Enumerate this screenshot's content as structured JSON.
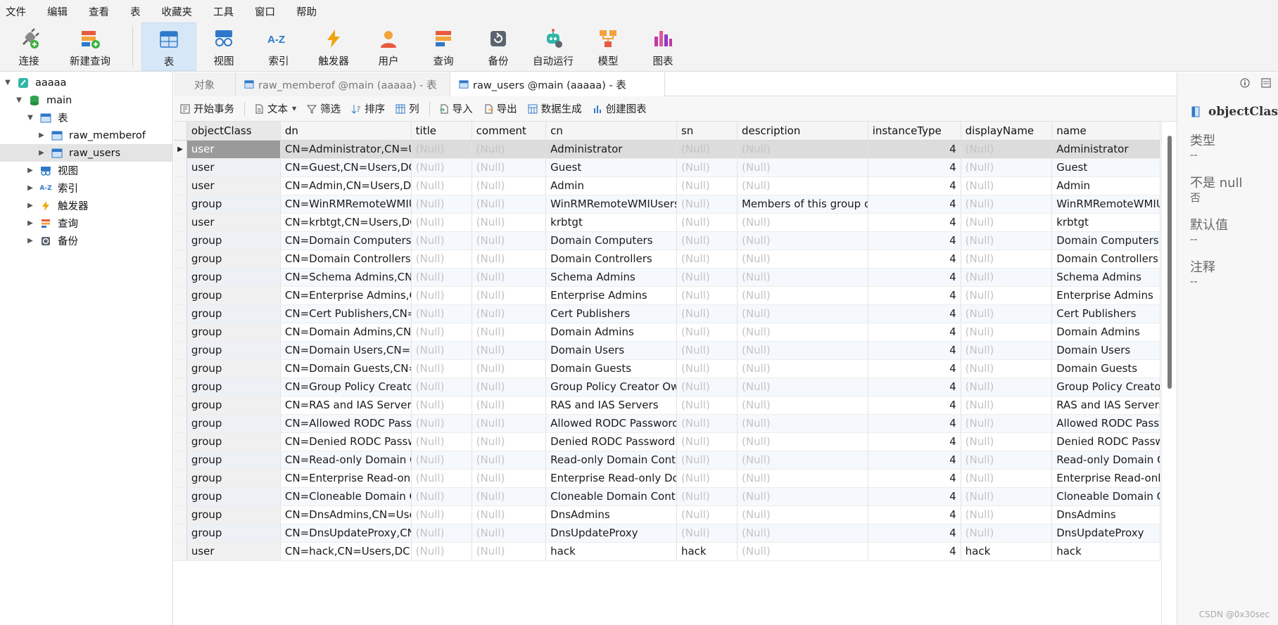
{
  "menu": [
    "文件",
    "编辑",
    "查看",
    "表",
    "收藏夹",
    "工具",
    "窗口",
    "帮助"
  ],
  "toolbar": {
    "left": [
      {
        "label": "连接",
        "icon": "connect-plug-icon"
      },
      {
        "label": "新建查询",
        "icon": "new-query-icon"
      }
    ],
    "right": [
      {
        "label": "表",
        "icon": "table-icon",
        "active": true
      },
      {
        "label": "视图",
        "icon": "view-icon"
      },
      {
        "label": "索引",
        "icon": "index-az-icon"
      },
      {
        "label": "触发器",
        "icon": "trigger-bolt-icon"
      },
      {
        "label": "用户",
        "icon": "user-icon"
      },
      {
        "label": "查询",
        "icon": "query-icon"
      },
      {
        "label": "备份",
        "icon": "backup-icon"
      },
      {
        "label": "自动运行",
        "icon": "robot-icon"
      },
      {
        "label": "模型",
        "icon": "model-icon"
      },
      {
        "label": "图表",
        "icon": "chart-icon"
      }
    ]
  },
  "tree": {
    "connection": "aaaaa",
    "database": "main",
    "tables_label": "表",
    "tables": [
      "raw_memberof",
      "raw_users"
    ],
    "others": [
      "视图",
      "索引",
      "触发器",
      "查询",
      "备份"
    ]
  },
  "tabs": {
    "objects": "对象",
    "tab1": "raw_memberof @main (aaaaa) - 表",
    "tab2": "raw_users @main (aaaaa) - 表"
  },
  "subtoolbar": {
    "begin_tx": "开始事务",
    "text": "文本",
    "filter": "筛选",
    "sort": "排序",
    "columns": "列",
    "import": "导入",
    "export": "导出",
    "datagen": "数据生成",
    "create_chart": "创建图表"
  },
  "grid": {
    "null_text": "(Null)",
    "columns": [
      "objectClass",
      "dn",
      "title",
      "comment",
      "cn",
      "sn",
      "description",
      "instanceType",
      "displayName",
      "name"
    ],
    "rows": [
      [
        "user",
        "CN=Administrator,CN=Users,DC=",
        null,
        null,
        "Administrator",
        null,
        null,
        "4",
        null,
        "Administrator"
      ],
      [
        "user",
        "CN=Guest,CN=Users,DC=",
        null,
        null,
        "Guest",
        null,
        null,
        "4",
        null,
        "Guest"
      ],
      [
        "user",
        "CN=Admin,CN=Users,DC=",
        null,
        null,
        "Admin",
        null,
        null,
        "4",
        null,
        "Admin"
      ],
      [
        "group",
        "CN=WinRMRemoteWMIUsers",
        null,
        null,
        "WinRMRemoteWMIUsers",
        null,
        "Members of this group can",
        "4",
        null,
        "WinRMRemoteWMIUsers"
      ],
      [
        "user",
        "CN=krbtgt,CN=Users,DC=",
        null,
        null,
        "krbtgt",
        null,
        null,
        "4",
        null,
        "krbtgt"
      ],
      [
        "group",
        "CN=Domain Computers,CN=",
        null,
        null,
        "Domain Computers",
        null,
        null,
        "4",
        null,
        "Domain Computers"
      ],
      [
        "group",
        "CN=Domain Controllers,CN=",
        null,
        null,
        "Domain Controllers",
        null,
        null,
        "4",
        null,
        "Domain Controllers"
      ],
      [
        "group",
        "CN=Schema Admins,CN=",
        null,
        null,
        "Schema Admins",
        null,
        null,
        "4",
        null,
        "Schema Admins"
      ],
      [
        "group",
        "CN=Enterprise Admins,CN=",
        null,
        null,
        "Enterprise Admins",
        null,
        null,
        "4",
        null,
        "Enterprise Admins"
      ],
      [
        "group",
        "CN=Cert Publishers,CN=",
        null,
        null,
        "Cert Publishers",
        null,
        null,
        "4",
        null,
        "Cert Publishers"
      ],
      [
        "group",
        "CN=Domain Admins,CN=",
        null,
        null,
        "Domain Admins",
        null,
        null,
        "4",
        null,
        "Domain Admins"
      ],
      [
        "group",
        "CN=Domain Users,CN=U",
        null,
        null,
        "Domain Users",
        null,
        null,
        "4",
        null,
        "Domain Users"
      ],
      [
        "group",
        "CN=Domain Guests,CN=",
        null,
        null,
        "Domain Guests",
        null,
        null,
        "4",
        null,
        "Domain Guests"
      ],
      [
        "group",
        "CN=Group Policy Creator",
        null,
        null,
        "Group Policy Creator Ow",
        null,
        null,
        "4",
        null,
        "Group Policy Creator"
      ],
      [
        "group",
        "CN=RAS and IAS Servers",
        null,
        null,
        "RAS and IAS Servers",
        null,
        null,
        "4",
        null,
        "RAS and IAS Servers"
      ],
      [
        "group",
        "CN=Allowed RODC Pass",
        null,
        null,
        "Allowed RODC Password",
        null,
        null,
        "4",
        null,
        "Allowed RODC Passw"
      ],
      [
        "group",
        "CN=Denied RODC Passw",
        null,
        null,
        "Denied RODC Password",
        null,
        null,
        "4",
        null,
        "Denied RODC Passw"
      ],
      [
        "group",
        "CN=Read-only Domain C",
        null,
        null,
        "Read-only Domain Contr",
        null,
        null,
        "4",
        null,
        "Read-only Domain Co"
      ],
      [
        "group",
        "CN=Enterprise Read-onl",
        null,
        null,
        "Enterprise Read-only Do",
        null,
        null,
        "4",
        null,
        "Enterprise Read-only"
      ],
      [
        "group",
        "CN=Cloneable Domain C",
        null,
        null,
        "Cloneable Domain Contr",
        null,
        null,
        "4",
        null,
        "Cloneable Domain Co"
      ],
      [
        "group",
        "CN=DnsAdmins,CN=Use",
        null,
        null,
        "DnsAdmins",
        null,
        null,
        "4",
        null,
        "DnsAdmins"
      ],
      [
        "group",
        "CN=DnsUpdateProxy,CN",
        null,
        null,
        "DnsUpdateProxy",
        null,
        null,
        "4",
        null,
        "DnsUpdateProxy"
      ],
      [
        "user",
        "CN=hack,CN=Users,DC=",
        null,
        null,
        "hack",
        "hack",
        null,
        "4",
        "hack",
        "hack"
      ]
    ]
  },
  "inspector": {
    "field": "objectClass",
    "type_label": "类型",
    "type_value": "--",
    "notnull_label": "不是 null",
    "notnull_value": "否",
    "default_label": "默认值",
    "default_value": "--",
    "comment_label": "注释",
    "comment_value": "--"
  },
  "watermark": "CSDN @0x30sec",
  "colors": {
    "accent": "#1e7ad6",
    "toolbar_active": "#d6e8f8",
    "null_text": "#c3c3c3",
    "selected_row": "#dcdcdc"
  }
}
